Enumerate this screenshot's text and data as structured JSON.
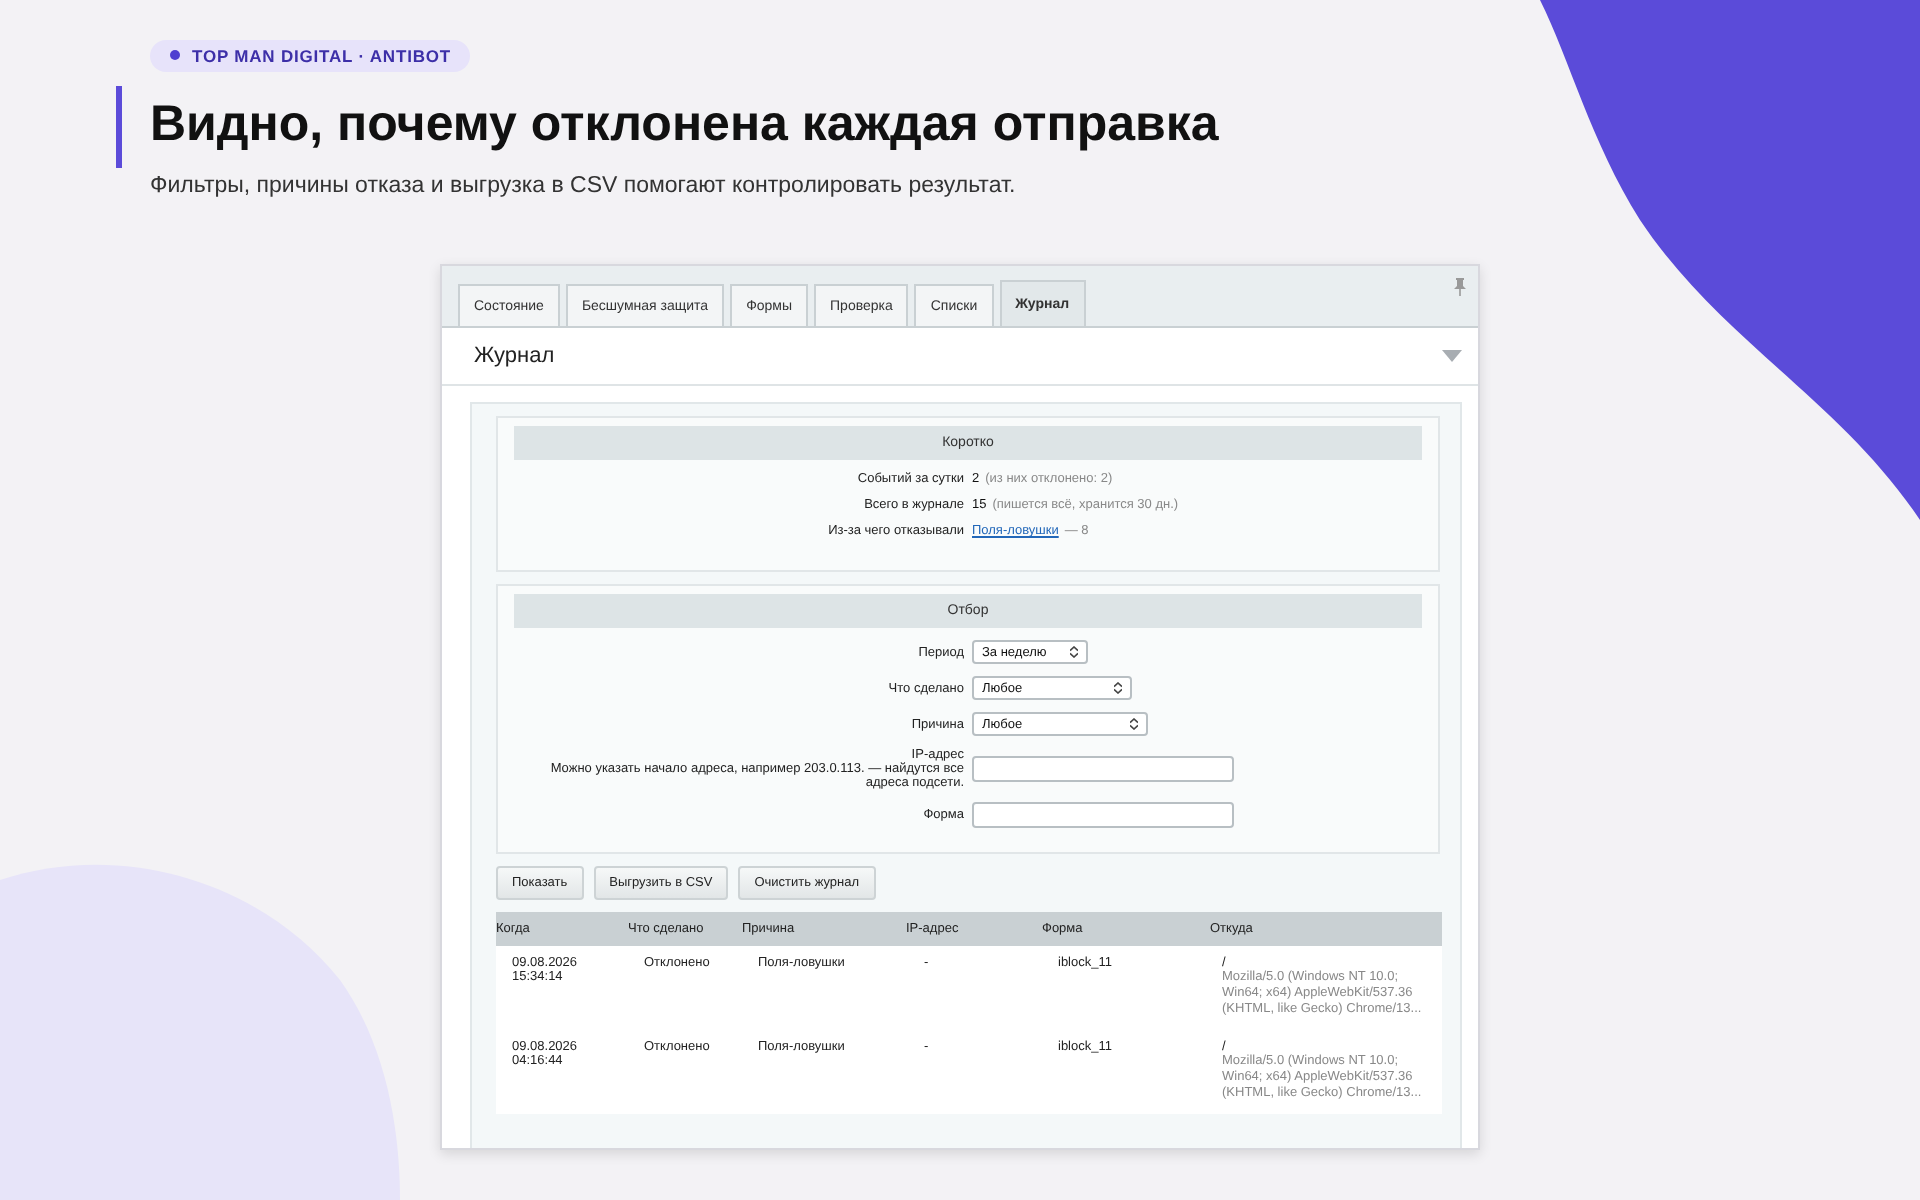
{
  "badge": "TOP MAN DIGITAL · ANTIBOT",
  "title": "Видно, почему отклонена каждая отправка",
  "subtitle": "Фильтры, причины отказа и выгрузка в CSV помогают контролировать результат.",
  "tabs": [
    {
      "label": "Состояние",
      "selected": false
    },
    {
      "label": "Бесшумная защита",
      "selected": false
    },
    {
      "label": "Формы",
      "selected": false
    },
    {
      "label": "Проверка",
      "selected": false
    },
    {
      "label": "Списки",
      "selected": false
    },
    {
      "label": "Журнал",
      "selected": true
    }
  ],
  "section_title": "Журнал",
  "summary": {
    "title": "Коротко",
    "rows": [
      {
        "label": "Событий за сутки",
        "value": "2",
        "note": "(из них отклонено: 2)"
      },
      {
        "label": "Всего в журнале",
        "value": "15",
        "note": "(пишется всё, хранится 30 дн.)"
      },
      {
        "label": "Из-за чего отказывали",
        "link": "Поля-ловушки",
        "note": "— 8"
      }
    ]
  },
  "filter": {
    "title": "Отбор",
    "fields": [
      {
        "kind": "select",
        "label": "Период",
        "value": "За неделю"
      },
      {
        "kind": "select",
        "label": "Что сделано",
        "value": "Любое"
      },
      {
        "kind": "select",
        "label": "Причина",
        "value": "Любое"
      },
      {
        "kind": "input",
        "label": "IP-адрес",
        "hint": "Можно указать начало адреса, например 203.0.113. — найдутся все адреса подсети."
      },
      {
        "kind": "input",
        "label": "Форма"
      }
    ]
  },
  "buttons": [
    "Показать",
    "Выгрузить в CSV",
    "Очистить журнал"
  ],
  "table": {
    "columns": [
      "Когда",
      "Что сделано",
      "Причина",
      "IP-адрес",
      "Форма",
      "Откуда"
    ],
    "rows": [
      {
        "when": "09.08.2026 15:34:14",
        "action": "Отклонено",
        "reason": "Поля-ловушки",
        "ip": "-",
        "form": "iblock_11",
        "path": "/",
        "agent": "Mozilla/5.0 (Windows NT 10.0; Win64; x64) AppleWebKit/537.36 (KHTML, like Gecko) Chrome/13..."
      },
      {
        "when": "09.08.2026 04:16:44",
        "action": "Отклонено",
        "reason": "Поля-ловушки",
        "ip": "-",
        "form": "iblock_11",
        "path": "/",
        "agent": "Mozilla/5.0 (Windows NT 10.0; Win64; x64) AppleWebKit/537.36 (KHTML, like Gecko) Chrome/13..."
      }
    ]
  }
}
